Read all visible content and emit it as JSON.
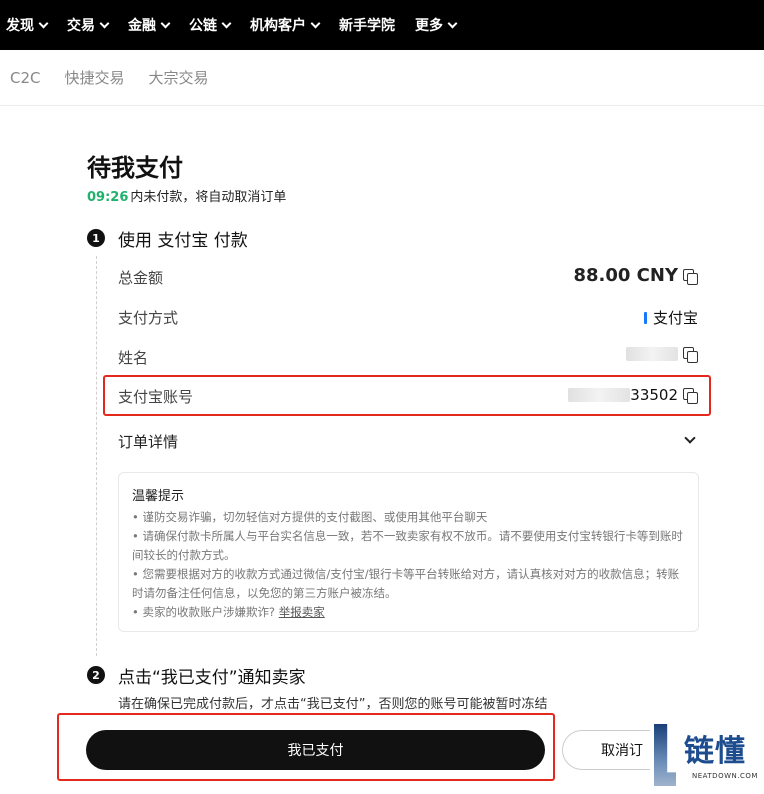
{
  "topnav": {
    "items": [
      {
        "label": "发现",
        "dropdown": true
      },
      {
        "label": "交易",
        "dropdown": true
      },
      {
        "label": "金融",
        "dropdown": true
      },
      {
        "label": "公链",
        "dropdown": true
      },
      {
        "label": "机构客户",
        "dropdown": true
      },
      {
        "label": "新手学院",
        "dropdown": false
      },
      {
        "label": "更多",
        "dropdown": true
      }
    ]
  },
  "subnav": {
    "items": [
      "C2C",
      "快捷交易",
      "大宗交易"
    ]
  },
  "page": {
    "title": "待我支付",
    "timer": "09:26",
    "timer_text": "内未付款，将自动取消订单"
  },
  "step1": {
    "badge": "1",
    "title": "使用 支付宝 付款",
    "total_label": "总金额",
    "total_value": "88.00 CNY",
    "method_label": "支付方式",
    "method_value": "支付宝",
    "name_label": "姓名",
    "name_value_suffix": "",
    "account_label": "支付宝账号",
    "account_value_suffix": "33502",
    "order_details_label": "订单详情"
  },
  "notice": {
    "title": "温馨提示",
    "items": [
      "• 谨防交易诈骗，切勿轻信对方提供的支付截图、或使用其他平台聊天",
      "• 请确保付款卡所属人与平台实名信息一致，若不一致卖家有权不放币。请不要使用支付宝转银行卡等到账时间较长的付款方式。",
      "• 您需要根据对方的收款方式通过微信/支付宝/银行卡等平台转账给对方，请认真核对对方的收款信息；转账时请勿备注任何信息，以免您的第三方账户被冻结。"
    ],
    "last_item_text": "• 卖家的收款账户涉嫌欺诈?",
    "report_link": "举报卖家"
  },
  "step2": {
    "badge": "2",
    "title": "点击“我已支付”通知卖家",
    "desc": "请在确保已完成付款后，才点击“我已支付”，否则您的账号可能被暂时冻结"
  },
  "actions": {
    "paid_button": "我已支付",
    "cancel_button": "取消订"
  },
  "watermark": {
    "text": "链懂",
    "sub": "NEATDOWN.COM"
  },
  "colors": {
    "nav_bg": "#000000",
    "timer_green": "#20b26c",
    "alipay_blue": "#1677ff",
    "highlight_red": "#e3291c",
    "primary_button": "#111111"
  }
}
